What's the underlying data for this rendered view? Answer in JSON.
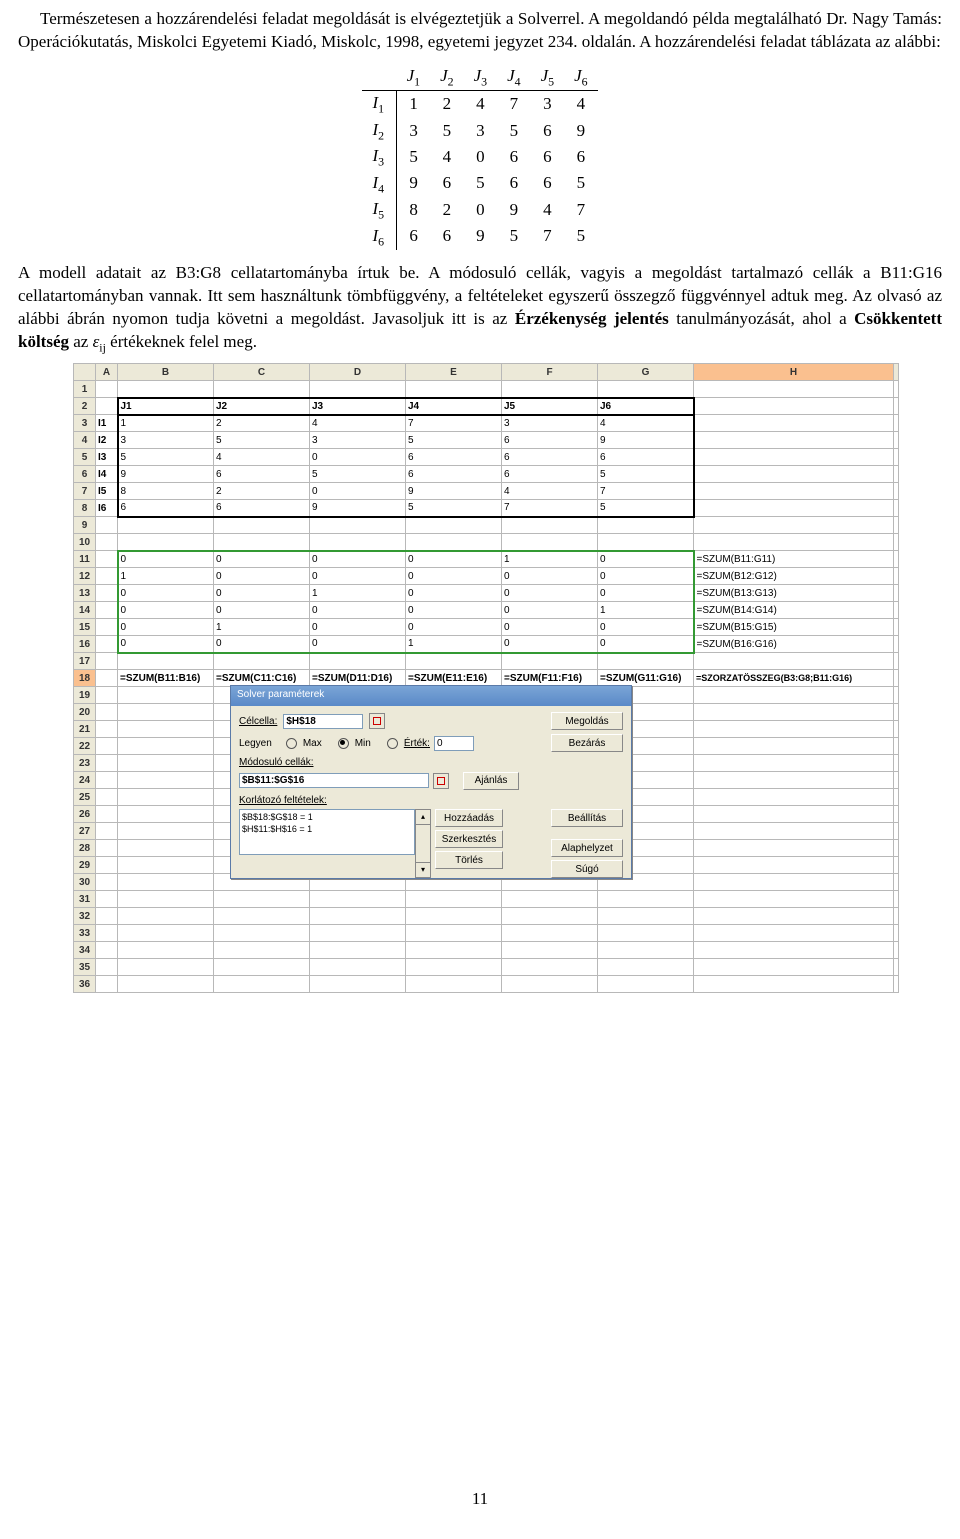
{
  "text": {
    "p1_a": "Természetesen a hozzárendelési feladat megoldását is elvégeztetjük a Solverrel. A megoldandó példa megtalálható Dr. Nagy Tamás: Operációkutatás, Miskolci Egyetemi Kiadó, Miskolc, 1998, egyetemi jegyzet 234. oldalán. A hozzárendelési feladat táblázata az alábbi:",
    "p2_a": "A modell adatait az B3:G8 cellatartományba írtuk be. A módosuló cellák, vagyis a megoldást tartalmazó cellák a B11:G16 cellatartományban vannak. Itt sem használtunk tömbfüggvény, a feltételeket egyszerű összegző függvénnyel adtuk meg. Az olvasó az alábbi ábrán nyomon tudja követni a megoldást. Javasoljuk itt is az ",
    "p2_b": "Érzékenység jelentés",
    "p2_c": " tanulmányozását, ahol a ",
    "p2_d": "Csökkentett költség",
    "p2_e": " az ",
    "p2_eps": "ε",
    "p2_ij": "ij",
    "p2_f": " értékeknek felel meg."
  },
  "assignment_table": {
    "col_headers": [
      "J₁",
      "J₂",
      "J₃",
      "J₄",
      "J₅",
      "J₆"
    ],
    "row_headers": [
      "I₁",
      "I₂",
      "I₃",
      "I₄",
      "I₅",
      "I₆"
    ],
    "rows": [
      [
        "1",
        "2",
        "4",
        "7",
        "3",
        "4"
      ],
      [
        "3",
        "5",
        "3",
        "5",
        "6",
        "9"
      ],
      [
        "5",
        "4",
        "0",
        "6",
        "6",
        "6"
      ],
      [
        "9",
        "6",
        "5",
        "6",
        "6",
        "5"
      ],
      [
        "8",
        "2",
        "0",
        "9",
        "4",
        "7"
      ],
      [
        "6",
        "6",
        "9",
        "5",
        "7",
        "5"
      ]
    ]
  },
  "sheet": {
    "col_letters": [
      "A",
      "B",
      "C",
      "D",
      "E",
      "F",
      "G",
      "H"
    ],
    "r2": [
      "",
      "J1",
      "J2",
      "J3",
      "J4",
      "J5",
      "J6",
      ""
    ],
    "r3": [
      "I1",
      "1",
      "2",
      "4",
      "7",
      "3",
      "4",
      ""
    ],
    "r4": [
      "I2",
      "3",
      "5",
      "3",
      "5",
      "6",
      "9",
      ""
    ],
    "r5": [
      "I3",
      "5",
      "4",
      "0",
      "6",
      "6",
      "6",
      ""
    ],
    "r6": [
      "I4",
      "9",
      "6",
      "5",
      "6",
      "6",
      "5",
      ""
    ],
    "r7": [
      "I5",
      "8",
      "2",
      "0",
      "9",
      "4",
      "7",
      ""
    ],
    "r8": [
      "I6",
      "6",
      "6",
      "9",
      "5",
      "7",
      "5",
      ""
    ],
    "r11": [
      "",
      "0",
      "0",
      "0",
      "0",
      "1",
      "0",
      "=SZUM(B11:G11)"
    ],
    "r12": [
      "",
      "1",
      "0",
      "0",
      "0",
      "0",
      "0",
      "=SZUM(B12:G12)"
    ],
    "r13": [
      "",
      "0",
      "0",
      "1",
      "0",
      "0",
      "0",
      "=SZUM(B13:G13)"
    ],
    "r14": [
      "",
      "0",
      "0",
      "0",
      "0",
      "0",
      "1",
      "=SZUM(B14:G14)"
    ],
    "r15": [
      "",
      "0",
      "1",
      "0",
      "0",
      "0",
      "0",
      "=SZUM(B15:G15)"
    ],
    "r16": [
      "",
      "0",
      "0",
      "0",
      "1",
      "0",
      "0",
      "=SZUM(B16:G16)"
    ],
    "r18": [
      "",
      "=SZUM(B11:B16)",
      "=SZUM(C11:C16)",
      "=SZUM(D11:D16)",
      "=SZUM(E11:E16)",
      "=SZUM(F11:F16)",
      "=SZUM(G11:G16)",
      "=SZORZATÖSSZEG(B3:G8;B11:G16)"
    ]
  },
  "solver": {
    "title": "Solver paraméterek",
    "target_label": "Célcella:",
    "target_value": "$H$18",
    "equal_label": "Legyen",
    "opt_max": "Max",
    "opt_min": "Min",
    "opt_val": "Érték:",
    "val_value": "0",
    "changing_label": "Módosuló cellák:",
    "changing_value": "$B$11:$G$16",
    "constraints_label": "Korlátozó feltételek:",
    "constraints": [
      "$B$18:$G$18 = 1",
      "$H$11:$H$16 = 1"
    ],
    "btn_solve": "Megoldás",
    "btn_close": "Bezárás",
    "btn_guess": "Ajánlás",
    "btn_options": "Beállítás",
    "btn_add": "Hozzáadás",
    "btn_change": "Szerkesztés",
    "btn_delete": "Törlés",
    "btn_reset": "Alaphelyzet",
    "btn_help": "Súgó"
  },
  "page_number": "11"
}
